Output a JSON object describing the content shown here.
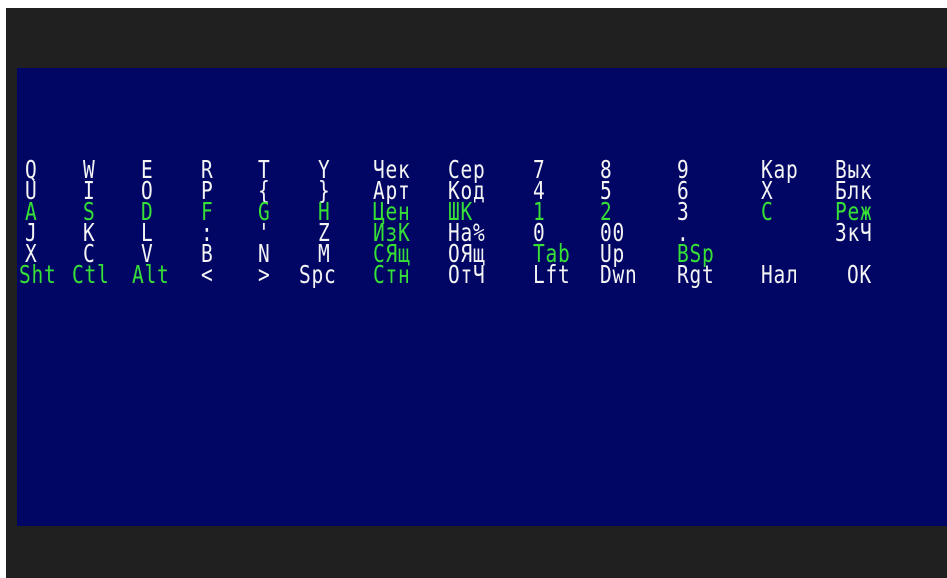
{
  "colors": {
    "screen_background": "#010664",
    "frame": "#202020",
    "text_white": "#f4f4f4",
    "text_green": "#36e036"
  },
  "keyboard": {
    "rows": [
      [
        {
          "label": "Q",
          "color": "white"
        },
        {
          "label": "W",
          "color": "white"
        },
        {
          "label": "E",
          "color": "white"
        },
        {
          "label": "R",
          "color": "white"
        },
        {
          "label": "T",
          "color": "white"
        },
        {
          "label": "Y",
          "color": "white"
        },
        {
          "label": "Чек",
          "color": "white"
        },
        {
          "label": "Сер",
          "color": "white"
        },
        {
          "label": "7",
          "color": "white"
        },
        {
          "label": "8",
          "color": "white"
        },
        {
          "label": "9",
          "color": "white"
        },
        {
          "label": "Кар",
          "color": "white"
        },
        {
          "label": "Вых",
          "color": "white"
        }
      ],
      [
        {
          "label": "U",
          "color": "white"
        },
        {
          "label": "I",
          "color": "white"
        },
        {
          "label": "O",
          "color": "white"
        },
        {
          "label": "P",
          "color": "white"
        },
        {
          "label": "{",
          "color": "white"
        },
        {
          "label": "}",
          "color": "white"
        },
        {
          "label": "Арт",
          "color": "white"
        },
        {
          "label": "Код",
          "color": "white"
        },
        {
          "label": "4",
          "color": "white"
        },
        {
          "label": "5",
          "color": "white"
        },
        {
          "label": "6",
          "color": "white"
        },
        {
          "label": "X",
          "color": "white"
        },
        {
          "label": "Блк",
          "color": "white"
        }
      ],
      [
        {
          "label": "A",
          "color": "green"
        },
        {
          "label": "S",
          "color": "green"
        },
        {
          "label": "D",
          "color": "green"
        },
        {
          "label": "F",
          "color": "green"
        },
        {
          "label": "G",
          "color": "green"
        },
        {
          "label": "H",
          "color": "green"
        },
        {
          "label": "Цен",
          "color": "green"
        },
        {
          "label": "ШК",
          "color": "green"
        },
        {
          "label": "1",
          "color": "green"
        },
        {
          "label": "2",
          "color": "green"
        },
        {
          "label": "3",
          "color": "white"
        },
        {
          "label": "C",
          "color": "green"
        },
        {
          "label": "Реж",
          "color": "green"
        }
      ],
      [
        {
          "label": "J",
          "color": "white"
        },
        {
          "label": "K",
          "color": "white"
        },
        {
          "label": "L",
          "color": "white"
        },
        {
          "label": ":",
          "color": "white"
        },
        {
          "label": "'",
          "color": "white"
        },
        {
          "label": "Z",
          "color": "white"
        },
        {
          "label": "ИзК",
          "color": "green"
        },
        {
          "label": "На%",
          "color": "white"
        },
        {
          "label": "0",
          "color": "white"
        },
        {
          "label": "00",
          "color": "white"
        },
        {
          "label": ".",
          "color": "white"
        },
        {
          "label": "",
          "color": "white"
        },
        {
          "label": "ЗкЧ",
          "color": "white"
        }
      ],
      [
        {
          "label": "X",
          "color": "white"
        },
        {
          "label": "C",
          "color": "white"
        },
        {
          "label": "V",
          "color": "white"
        },
        {
          "label": "B",
          "color": "white"
        },
        {
          "label": "N",
          "color": "white"
        },
        {
          "label": "M",
          "color": "white"
        },
        {
          "label": "СЯщ",
          "color": "green"
        },
        {
          "label": "ОЯщ",
          "color": "white"
        },
        {
          "label": "Tab",
          "color": "green"
        },
        {
          "label": "Up",
          "color": "white"
        },
        {
          "label": "BSp",
          "color": "green"
        },
        {
          "label": "",
          "color": "white"
        },
        {
          "label": "",
          "color": "white"
        }
      ],
      [
        {
          "label": "Sht",
          "color": "green"
        },
        {
          "label": "Ctl",
          "color": "green"
        },
        {
          "label": "Alt",
          "color": "green"
        },
        {
          "label": "<",
          "color": "white"
        },
        {
          "label": ">",
          "color": "white"
        },
        {
          "label": "Spc",
          "color": "white"
        },
        {
          "label": "Стн",
          "color": "green"
        },
        {
          "label": "ОтЧ",
          "color": "white"
        },
        {
          "label": "Lft",
          "color": "white"
        },
        {
          "label": "Dwn",
          "color": "white"
        },
        {
          "label": "Rgt",
          "color": "white"
        },
        {
          "label": "Нал",
          "color": "white"
        },
        {
          "label": "OK",
          "color": "white"
        }
      ]
    ]
  }
}
